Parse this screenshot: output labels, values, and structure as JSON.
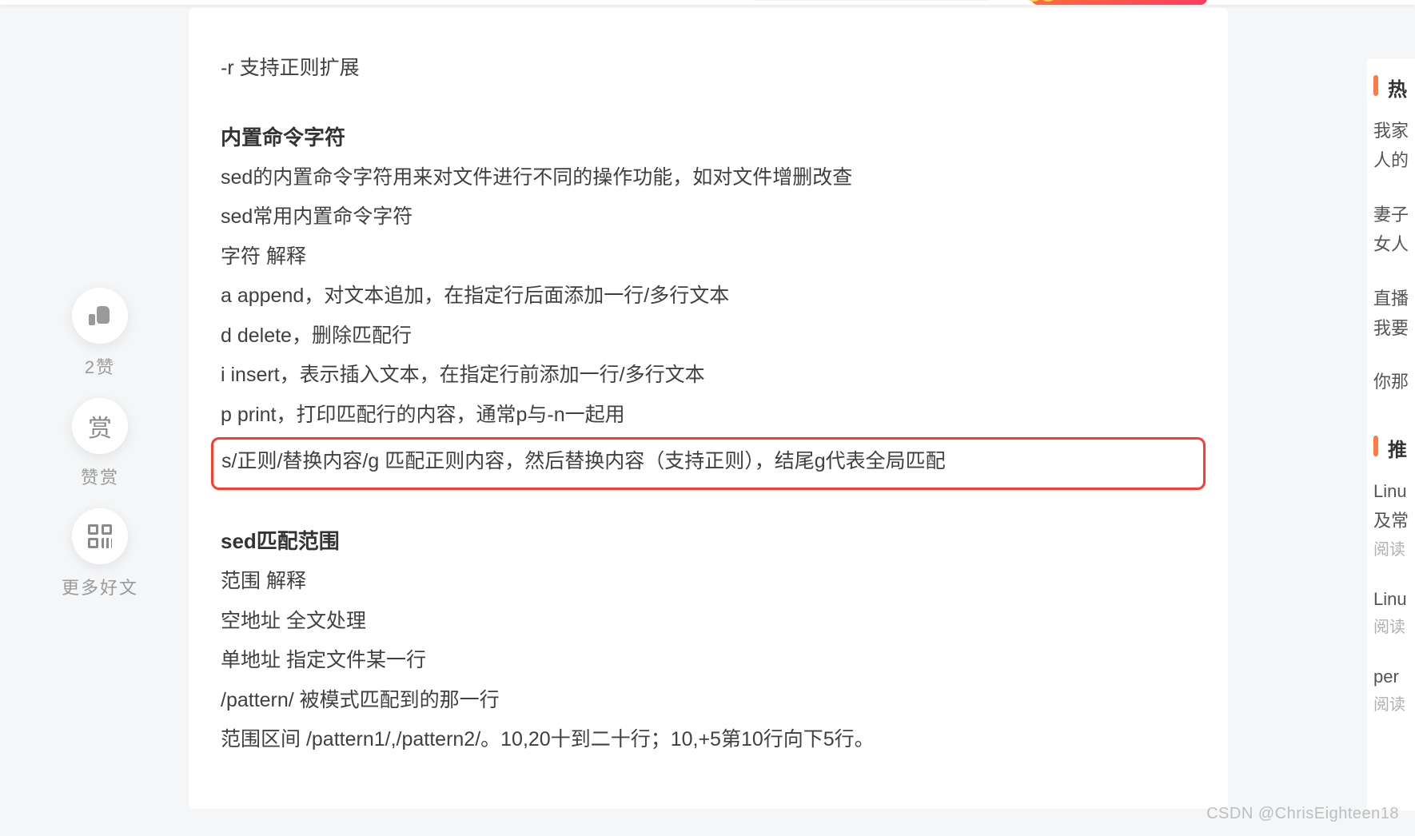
{
  "article": {
    "top_line": "-r 支持正则扩展",
    "s1_title": "内置命令字符",
    "s1_lines": [
      "sed的内置命令字符用来对文件进行不同的操作功能，如对文件增删改查",
      "sed常用内置命令字符",
      "字符 解释",
      "a append，对文本追加，在指定行后面添加一行/多行文本",
      "d delete，删除匹配行",
      "i insert，表示插入文本，在指定行前添加一行/多行文本",
      "p print，打印匹配行的内容，通常p与-n一起用"
    ],
    "s1_highlight": "s/正则/替换内容/g 匹配正则内容，然后替换内容（支持正则），结尾g代表全局匹配",
    "s2_title": "sed匹配范围",
    "s2_lines": [
      "范围 解释",
      "空地址 全文处理",
      "单地址 指定文件某一行",
      "/pattern/ 被模式匹配到的那一行",
      "范围区间 /pattern1/,/pattern2/。10,20十到二十行；10,+5第10行向下5行。"
    ]
  },
  "leftrail": {
    "like_label": "2赞",
    "reward_icon": "赏",
    "reward_label": "赞赏",
    "more_label": "更多好文"
  },
  "sidebar": {
    "hot_heading": "热",
    "hot_items": [
      {
        "l1": "我家",
        "l2": "人的"
      },
      {
        "l1": "妻子",
        "l2": "女人"
      },
      {
        "l1": "直播",
        "l2": "我要"
      },
      {
        "l1": "你那",
        "l2": ""
      }
    ],
    "rec_heading": "推",
    "rec_items": [
      {
        "l1": "Linu",
        "l2": "及常",
        "sub": "阅读"
      },
      {
        "l1": "Linu",
        "l2": "",
        "sub": "阅读"
      },
      {
        "l1": "per",
        "l2": "",
        "sub": "阅读"
      }
    ]
  },
  "watermark": "CSDN @ChrisEighteen18"
}
